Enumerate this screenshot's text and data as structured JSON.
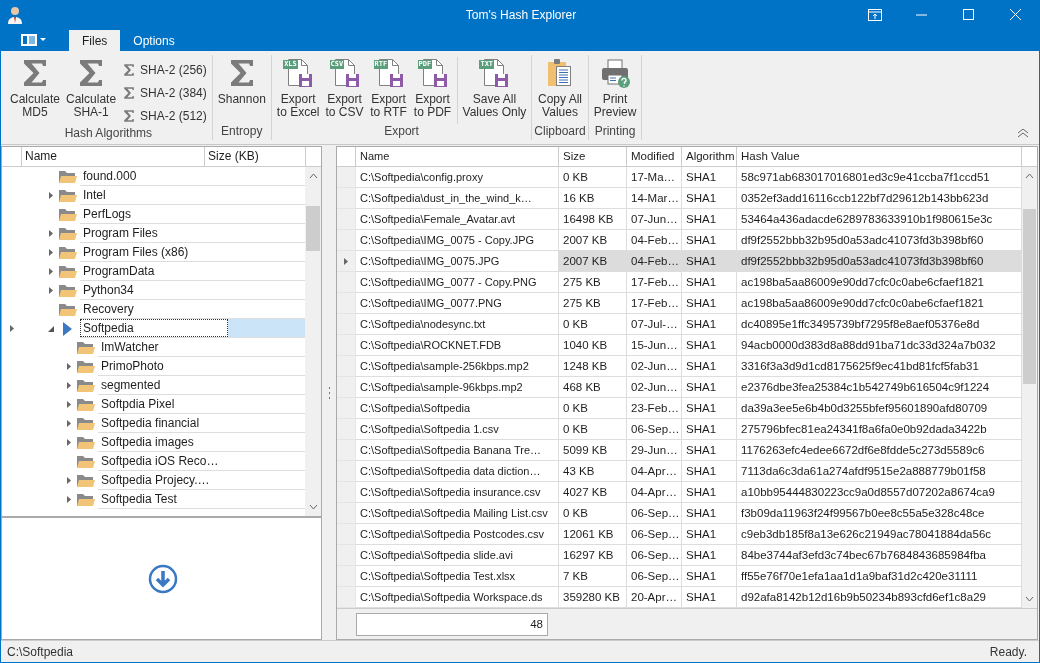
{
  "window": {
    "title": "Tom's Hash Explorer"
  },
  "tabs": [
    {
      "label": "Files",
      "selected": true
    },
    {
      "label": "Options",
      "selected": false
    }
  ],
  "ribbon": {
    "groups": [
      {
        "label": "Hash Algorithms",
        "buttons": [
          {
            "kind": "sigma_large",
            "label": "Calculate\nMD5"
          },
          {
            "kind": "sigma_large",
            "label": "Calculate\nSHA-1"
          },
          {
            "kind": "sigma_small",
            "label": "SHA-2 (256)"
          },
          {
            "kind": "sigma_small",
            "label": "SHA-2 (384)"
          },
          {
            "kind": "sigma_small",
            "label": "SHA-2 (512)"
          }
        ]
      },
      {
        "label": "Entropy",
        "buttons": [
          {
            "kind": "sigma_large",
            "label": "Shannon"
          }
        ]
      },
      {
        "label": "Export",
        "buttons": [
          {
            "kind": "file_export",
            "badge": "XLS",
            "label": "Export\nto Excel"
          },
          {
            "kind": "file_export",
            "badge": "CSV",
            "label": "Export\nto CSV"
          },
          {
            "kind": "file_export",
            "badge": "RTF",
            "label": "Export\nto RTF"
          },
          {
            "kind": "file_export",
            "badge": "PDF",
            "label": "Export\nto PDF"
          },
          {
            "kind": "file_export",
            "badge": "TXT",
            "label": "Save All\nValues Only",
            "separator_before": true
          }
        ]
      },
      {
        "label": "Clipboard",
        "buttons": [
          {
            "kind": "clipboard",
            "label": "Copy All\nValues"
          }
        ]
      },
      {
        "label": "Printing",
        "buttons": [
          {
            "kind": "printer",
            "label": "Print\nPreview"
          }
        ]
      }
    ]
  },
  "tree": {
    "columns": [
      "Name",
      "Size (KB)"
    ],
    "items": [
      {
        "label": "found.000",
        "has_children": false,
        "expanded": false,
        "selected": false
      },
      {
        "label": "Intel",
        "has_children": true,
        "expanded": false,
        "selected": false
      },
      {
        "label": "PerfLogs",
        "has_children": false,
        "expanded": false,
        "selected": false
      },
      {
        "label": "Program Files",
        "has_children": true,
        "expanded": false,
        "selected": false
      },
      {
        "label": "Program Files (x86)",
        "has_children": true,
        "expanded": false,
        "selected": false
      },
      {
        "label": "ProgramData",
        "has_children": true,
        "expanded": false,
        "selected": false
      },
      {
        "label": "Python34",
        "has_children": true,
        "expanded": false,
        "selected": false
      },
      {
        "label": "Recovery",
        "has_children": false,
        "expanded": false,
        "selected": false
      },
      {
        "label": "Softpedia",
        "has_children": true,
        "expanded": true,
        "selected": true,
        "children": [
          {
            "label": "ImWatcher",
            "has_children": false,
            "expanded": false,
            "selected": false
          },
          {
            "label": "PrimoPhoto",
            "has_children": true,
            "expanded": false,
            "selected": false
          },
          {
            "label": "segmented",
            "has_children": true,
            "expanded": false,
            "selected": false
          },
          {
            "label": "Softpdia Pixel",
            "has_children": true,
            "expanded": false,
            "selected": false
          },
          {
            "label": "Softpedia financial",
            "has_children": true,
            "expanded": false,
            "selected": false
          },
          {
            "label": "Softpedia images",
            "has_children": true,
            "expanded": false,
            "selected": false
          },
          {
            "label": "Softpedia iOS Reco…",
            "has_children": false,
            "expanded": false,
            "selected": false
          },
          {
            "label": "Softpedia Projecy.…",
            "has_children": true,
            "expanded": false,
            "selected": false
          },
          {
            "label": "Softpedia Test",
            "has_children": true,
            "expanded": false,
            "selected": false
          }
        ]
      }
    ]
  },
  "table": {
    "columns": [
      "Name",
      "Size",
      "Modified",
      "Algorithm",
      "Hash Value"
    ],
    "rows": [
      {
        "cells": [
          "C:\\Softpedia\\config.proxy",
          "0 KB",
          "17-Ma…",
          "SHA1",
          "58c971ab683017016801ed3c9e41ccba7f1ccd51"
        ],
        "selected": false
      },
      {
        "cells": [
          "C:\\Softpedia\\dust_in_the_wind_k…",
          "16 KB",
          "14-Mar…",
          "SHA1",
          "0352ef3add16116ccb122bf7d29612b143bb623d"
        ],
        "selected": false
      },
      {
        "cells": [
          "C:\\Softpedia\\Female_Avatar.avt",
          "16498 KB",
          "07-Jun…",
          "SHA1",
          "53464a436adacde6289783633910b1f980615e3c"
        ],
        "selected": false
      },
      {
        "cells": [
          "C:\\Softpedia\\IMG_0075 - Copy.JPG",
          "2007 KB",
          "04-Feb…",
          "SHA1",
          "df9f2552bbb32b95d0a53adc41073fd3b398bf60"
        ],
        "selected": false
      },
      {
        "cells": [
          "C:\\Softpedia\\IMG_0075.JPG",
          "2007 KB",
          "04-Feb…",
          "SHA1",
          "df9f2552bbb32b95d0a53adc41073fd3b398bf60"
        ],
        "selected": true
      },
      {
        "cells": [
          "C:\\Softpedia\\IMG_0077 - Copy.PNG",
          "275 KB",
          "17-Feb…",
          "SHA1",
          "ac198ba5aa86009e90dd7cfc0c0abe6cfaef1821"
        ],
        "selected": false
      },
      {
        "cells": [
          "C:\\Softpedia\\IMG_0077.PNG",
          "275 KB",
          "17-Feb…",
          "SHA1",
          "ac198ba5aa86009e90dd7cfc0c0abe6cfaef1821"
        ],
        "selected": false
      },
      {
        "cells": [
          "C:\\Softpedia\\nodesync.txt",
          "0 KB",
          "07-Jul-…",
          "SHA1",
          "dc40895e1ffc3495739bf7295f8e8aef05376e8d"
        ],
        "selected": false
      },
      {
        "cells": [
          "C:\\Softpedia\\ROCKNET.FDB",
          "1040 KB",
          "15-Jun…",
          "SHA1",
          "94acb0000d383d8a88dd91ba71dc33d324a7b032"
        ],
        "selected": false
      },
      {
        "cells": [
          "C:\\Softpedia\\sample-256kbps.mp2",
          "1248 KB",
          "02-Jun…",
          "SHA1",
          "3316f3a3d9d1cd8175625f9ec41bd81fcf5fab31"
        ],
        "selected": false
      },
      {
        "cells": [
          "C:\\Softpedia\\sample-96kbps.mp2",
          "468 KB",
          "02-Jun…",
          "SHA1",
          "e2376dbe3fea25384c1b542749b616504c9f1224"
        ],
        "selected": false
      },
      {
        "cells": [
          "C:\\Softpedia\\Softpedia",
          "0 KB",
          "23-Feb…",
          "SHA1",
          "da39a3ee5e6b4b0d3255bfef95601890afd80709"
        ],
        "selected": false
      },
      {
        "cells": [
          "C:\\Softpedia\\Softpedia 1.csv",
          "0 KB",
          "06-Sep…",
          "SHA1",
          "275796bfec81ea24341f8a6fa0e0b92dada3422b"
        ],
        "selected": false
      },
      {
        "cells": [
          "C:\\Softpedia\\Softpedia Banana Tre…",
          "5099 KB",
          "29-Jun…",
          "SHA1",
          "1176263efc4edee6672df6e8fdde5c273d5589c6"
        ],
        "selected": false
      },
      {
        "cells": [
          "C:\\Softpedia\\Softpedia data diction…",
          "43 KB",
          "04-Apr…",
          "SHA1",
          "7113da6c3da61a274afdf9515e2a888779b01f58"
        ],
        "selected": false
      },
      {
        "cells": [
          "C:\\Softpedia\\Softpedia insurance.csv",
          "4027 KB",
          "04-Apr…",
          "SHA1",
          "a10bb95444830223cc9a0d8557d07202a8674ca9"
        ],
        "selected": false
      },
      {
        "cells": [
          "C:\\Softpedia\\Softpedia Mailing List.csv",
          "0 KB",
          "06-Sep…",
          "SHA1",
          "f3b09da11963f24f99567b0ee8c55a5e328c48ce"
        ],
        "selected": false
      },
      {
        "cells": [
          "C:\\Softpedia\\Softpedia Postcodes.csv",
          "12061 KB",
          "06-Sep…",
          "SHA1",
          "c9eb3db185f8a13e626c21949ac78041884da56c"
        ],
        "selected": false
      },
      {
        "cells": [
          "C:\\Softpedia\\Softpedia slide.avi",
          "16297 KB",
          "06-Sep…",
          "SHA1",
          "84be3744af3efd3c74bec67b7684843685984fba"
        ],
        "selected": false
      },
      {
        "cells": [
          "C:\\Softpedia\\Softpedia Test.xlsx",
          "7 KB",
          "06-Sep…",
          "SHA1",
          "ff55e76f70e1efa1aa1d1a9baf31d2c420e31111"
        ],
        "selected": false
      },
      {
        "cells": [
          "C:\\Softpedia\\Softpedia Workspace.ds",
          "359280 KB",
          "20-Apr…",
          "SHA1",
          "d92afa8142b12d16b9b50234b893cfd6ef1c8a29"
        ],
        "selected": false
      }
    ],
    "footer_count": "48"
  },
  "status_bar": {
    "path": "C:\\Softpedia",
    "message": "Ready."
  }
}
